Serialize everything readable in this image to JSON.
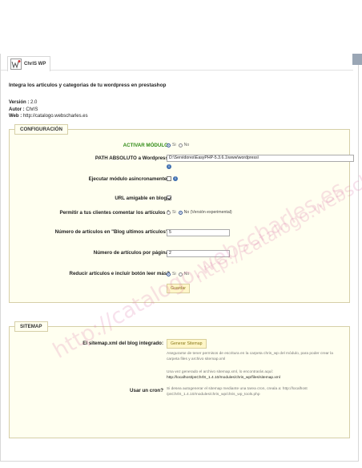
{
  "header": {
    "title": "ChrlS WP"
  },
  "subtitle": "Integra los articulos y categorias de tu wordpress en prestashop",
  "meta": {
    "version_label": "Versión :",
    "version_value": "2.0",
    "author_label": "Autor :",
    "author_value": "ChrlS",
    "web_label": "Web :",
    "web_value": "http://catalogo.webscharles.es"
  },
  "config": {
    "legend": "CONFIGURACIÓN",
    "activar": {
      "label": "ACTIVAR MÓDULO:",
      "yes": "Si",
      "no": "No"
    },
    "path": {
      "label": "PATH ABSOLUTO a Wordpress:",
      "value": "D:\\Servidores\\EasyPHP-5.3.6.1\\www\\wordpress\\"
    },
    "async": {
      "label": "Ejecutar módulo asincronamente?"
    },
    "url": {
      "label": "URL amigable en blog?"
    },
    "comments": {
      "label": "Permitir a tus clientes comentar los artículos ?",
      "yes": "Si",
      "no": "No (Versión experimental)"
    },
    "num_ultimos": {
      "label": "Número de artículos en \"Blog ultimos artículos\":",
      "value": "5"
    },
    "num_pagina": {
      "label": "Número de artículos por página:",
      "value": "2"
    },
    "reducir": {
      "label": "Reducir artículos e incluir botón leer más?",
      "yes": "Si",
      "no": "No"
    },
    "save_label": "Guardar"
  },
  "sitemap": {
    "legend": "SITEMAP",
    "label": "El sitemap.xml del blog integrado:",
    "button": "Generar Sitemap",
    "note1": "Asegurarse de tener permisos de escritura en la carpeta chris_wp del módulo, para poder crear la carpeta files y archivo sitemap.xml",
    "note2": "Una vez generado el archivo sitemap.xml, lo encontrarás aquí:",
    "note2_link": "http://localhost/psChrlS_1.4.10/modules/chris_wp/files/sitemap.xml",
    "cron_label": "Usar un cron?",
    "cron_note": "Si desea autogenerar el sitemap mediante una tarea cron, creala a: http://localhost /psChrlS_1.4.10/modules/chris_wp/chris_wp_tools.php"
  },
  "watermark": "http://catalogo.webscharles.es",
  "icons": {
    "logo": "wp-logo-icon",
    "info": "info-icon"
  }
}
